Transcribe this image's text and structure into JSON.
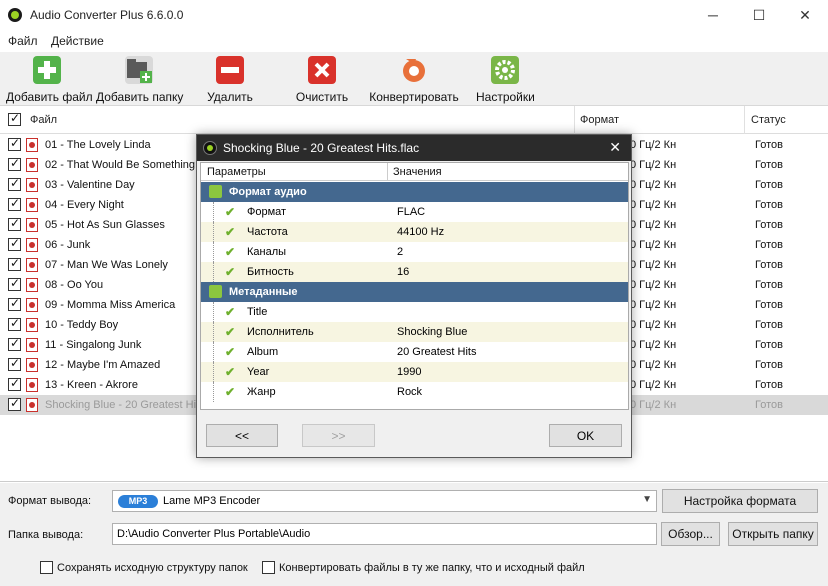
{
  "window": {
    "title": "Audio Converter Plus 6.6.0.0"
  },
  "menu": [
    "Файл",
    "Действие"
  ],
  "toolbar": [
    {
      "label": "Добавить файл",
      "icon": "add-file-icon",
      "color": "#53b34a"
    },
    {
      "label": "Добавить папку",
      "icon": "add-folder-icon",
      "color": "#5a5a5a"
    },
    {
      "label": "Удалить",
      "icon": "remove-icon",
      "color": "#d9322b"
    },
    {
      "label": "Очистить",
      "icon": "clear-icon",
      "color": "#d9322b"
    },
    {
      "label": "Конвертировать",
      "icon": "convert-icon",
      "color": "#e8703a"
    },
    {
      "label": "Настройки",
      "icon": "settings-icon",
      "color": "#7ab648"
    }
  ],
  "columns": {
    "file": "Файл",
    "format": "Формат",
    "status": "Статус"
  },
  "files": [
    {
      "name": "01 - The Lovely Linda",
      "format": "0 Гц/2 Кн",
      "status": "Готов"
    },
    {
      "name": "02 - That Would Be Something",
      "format": "0 Гц/2 Кн",
      "status": "Готов"
    },
    {
      "name": "03 - Valentine Day",
      "format": "0 Гц/2 Кн",
      "status": "Готов"
    },
    {
      "name": "04 - Every Night",
      "format": "0 Гц/2 Кн",
      "status": "Готов"
    },
    {
      "name": "05 - Hot As Sun Glasses",
      "format": "0 Гц/2 Кн",
      "status": "Готов"
    },
    {
      "name": "06 - Junk",
      "format": "0 Гц/2 Кн",
      "status": "Готов"
    },
    {
      "name": "07 - Man We Was Lonely",
      "format": "0 Гц/2 Кн",
      "status": "Готов"
    },
    {
      "name": "08 - Oo You",
      "format": "0 Гц/2 Кн",
      "status": "Готов"
    },
    {
      "name": "09 - Momma Miss America",
      "format": "0 Гц/2 Кн",
      "status": "Готов"
    },
    {
      "name": "10 - Teddy Boy",
      "format": "0 Гц/2 Кн",
      "status": "Готов"
    },
    {
      "name": "11 - Singalong Junk",
      "format": "0 Гц/2 Кн",
      "status": "Готов"
    },
    {
      "name": "12 - Maybe I'm Amazed",
      "format": "0 Гц/2 Кн",
      "status": "Готов"
    },
    {
      "name": "13 - Kreen - Akrore",
      "format": "0 Гц/2 Кн",
      "status": "Готов"
    },
    {
      "name": "Shocking Blue - 20 Greatest Hits",
      "format": "0 Гц/2 Кн",
      "status": "Готов",
      "selected": true
    }
  ],
  "output": {
    "format_label": "Формат вывода:",
    "format_badge": "MP3",
    "format_value": "Lame MP3 Encoder",
    "format_settings_button": "Настройка формата",
    "folder_label": "Папка вывода:",
    "folder_value": "D:\\Audio Converter Plus Portable\\Audio",
    "browse_button": "Обзор...",
    "open_folder_button": "Открыть папку",
    "keep_structure": "Сохранять исходную структуру папок",
    "same_folder": "Конвертировать файлы в ту же папку, что и исходный файл"
  },
  "dialog": {
    "title": "Shocking Blue - 20 Greatest Hits.flac",
    "col_params": "Параметры",
    "col_values": "Значения",
    "groups": [
      {
        "title": "Формат аудио",
        "rows": [
          {
            "name": "Формат",
            "value": "FLAC"
          },
          {
            "name": "Частота",
            "value": "44100 Hz"
          },
          {
            "name": "Каналы",
            "value": "2"
          },
          {
            "name": "Битность",
            "value": "16"
          }
        ]
      },
      {
        "title": "Метаданные",
        "rows": [
          {
            "name": "Title",
            "value": ""
          },
          {
            "name": "Исполнитель",
            "value": "Shocking Blue"
          },
          {
            "name": "Album",
            "value": "20 Greatest Hits"
          },
          {
            "name": "Year",
            "value": "1990"
          },
          {
            "name": "Жанр",
            "value": "Rock"
          }
        ]
      }
    ],
    "prev_button": "<<",
    "next_button": ">>",
    "ok_button": "OK"
  }
}
